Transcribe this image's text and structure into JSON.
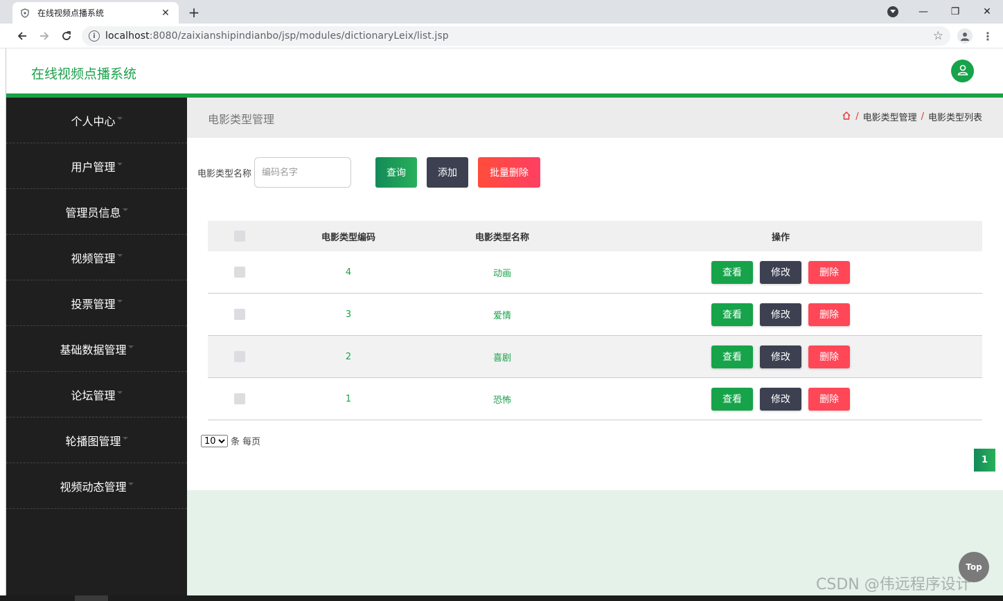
{
  "browser": {
    "tab_title": "在线视频点播系统",
    "url_host": "localhost",
    "url_rest": ":8080/zaixianshipindianbo/jsp/modules/dictionaryLeix/list.jsp"
  },
  "app": {
    "title": "在线视频点播系统"
  },
  "sidebar": {
    "items": [
      {
        "label": "个人中心"
      },
      {
        "label": "用户管理"
      },
      {
        "label": "管理员信息"
      },
      {
        "label": "视频管理"
      },
      {
        "label": "投票管理"
      },
      {
        "label": "基础数据管理"
      },
      {
        "label": "论坛管理"
      },
      {
        "label": "轮播图管理"
      },
      {
        "label": "视频动态管理"
      }
    ]
  },
  "page": {
    "title": "电影类型管理",
    "breadcrumb": [
      "电影类型管理",
      "电影类型列表"
    ]
  },
  "search": {
    "label": "电影类型名称",
    "placeholder": "编码名字",
    "query_label": "查询",
    "add_label": "添加",
    "batch_delete_label": "批量删除"
  },
  "table": {
    "headers": {
      "code": "电影类型编码",
      "name": "电影类型名称",
      "ops": "操作"
    },
    "rows": [
      {
        "code": "4",
        "name": "动画"
      },
      {
        "code": "3",
        "name": "爱情"
      },
      {
        "code": "2",
        "name": "喜剧"
      },
      {
        "code": "1",
        "name": "恐怖"
      }
    ],
    "actions": {
      "view": "查看",
      "edit": "修改",
      "delete": "删除"
    }
  },
  "pagination": {
    "page_size": "10",
    "page_size_options": [
      "10"
    ],
    "suffix": "条 每页",
    "current_page": "1"
  },
  "misc": {
    "top_label": "Top",
    "watermark": "CSDN @伟远程序设计"
  },
  "colors": {
    "brand_green": "#1ba14a",
    "sidebar_bg": "#1f1f1f",
    "danger": "#ff4757",
    "dark": "#3c4050"
  }
}
